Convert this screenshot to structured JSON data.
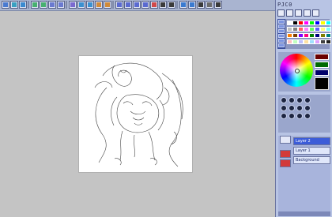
{
  "panel": {
    "header": "PJC0",
    "icons": [
      "brush-icon",
      "pen-icon",
      "bucket-icon",
      "eraser-icon",
      "select-icon"
    ]
  },
  "toolbar": {
    "buttons": [
      "new-file-icon",
      "open-file-icon",
      "save-file-icon",
      "undo-icon",
      "redo-icon",
      "copy-icon",
      "paste-icon",
      "hand-icon",
      "zoom-in-icon",
      "zoom-out-icon",
      "rotate-icon",
      "flip-icon",
      "rect-select-icon",
      "lasso-icon",
      "wand-icon",
      "move-icon",
      "eyedropper-icon",
      "brush-icon",
      "eraser-icon",
      "color-icon",
      "fill-icon",
      "text-icon",
      "grid-icon",
      "layer-icon"
    ]
  },
  "colors": {
    "accent": "#3c5cd8",
    "panel_bg": "#b8c4e4",
    "foreground": "#000000"
  },
  "layers": {
    "rows": [
      "Layer 2",
      "Layer 1",
      "Background"
    ]
  }
}
